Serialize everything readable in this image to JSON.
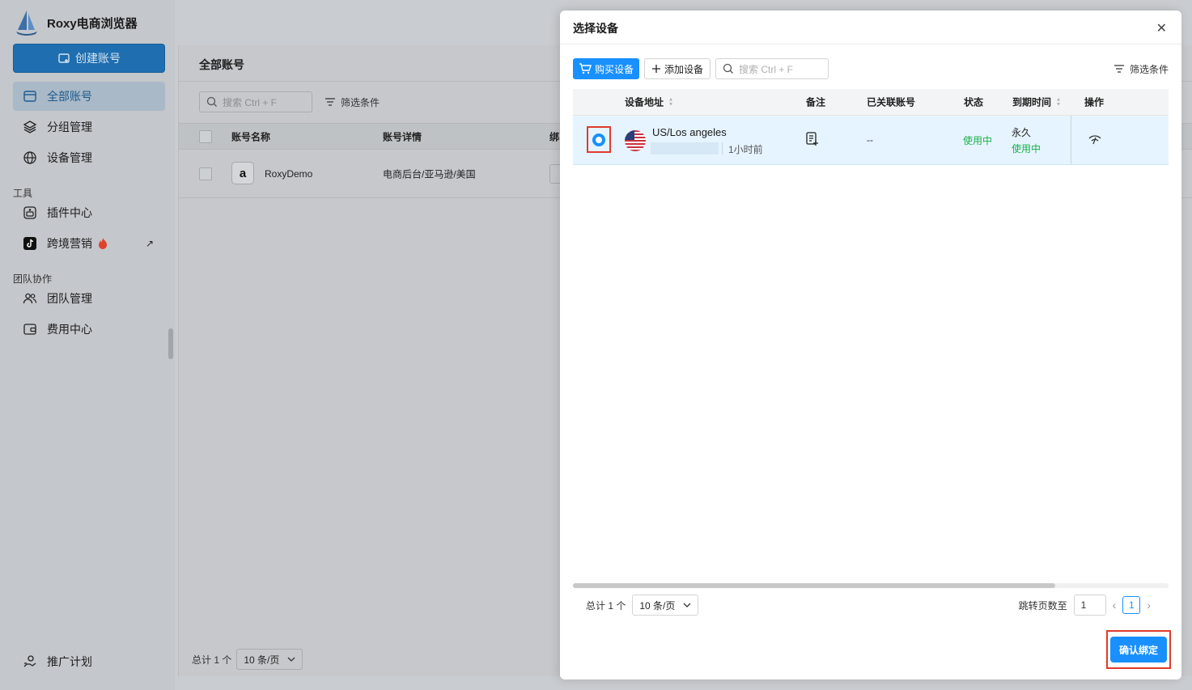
{
  "app": {
    "title": "Roxy电商浏览器"
  },
  "sidebar": {
    "create_label": "创建账号",
    "items": [
      {
        "label": "全部账号",
        "icon": "accounts-icon",
        "active": true
      },
      {
        "label": "分组管理",
        "icon": "layers-icon"
      },
      {
        "label": "设备管理",
        "icon": "globe-icon"
      }
    ],
    "tools_section": "工具",
    "tools": [
      {
        "label": "插件中心",
        "icon": "plugin-icon"
      },
      {
        "label": "跨境营销",
        "icon": "tiktok-icon",
        "badge": "fire-icon",
        "external": "↗"
      }
    ],
    "team_section": "团队协作",
    "team": [
      {
        "label": "团队管理",
        "icon": "team-icon"
      },
      {
        "label": "费用中心",
        "icon": "wallet-icon"
      }
    ],
    "bottom_item": {
      "label": "推广计划",
      "icon": "promo-icon"
    }
  },
  "main": {
    "title": "全部账号",
    "search_placeholder": "搜索 Ctrl + F",
    "filter_label": "筛选条件",
    "columns": [
      "账号名称",
      "账号详情",
      "绑"
    ],
    "rows": [
      {
        "name": "RoxyDemo",
        "detail": "电商后台/亚马逊/美国",
        "logo": "a"
      }
    ],
    "total": "总计 1 个",
    "page_size": "10 条/页"
  },
  "modal": {
    "title": "选择设备",
    "close": "✕",
    "buy_label": "购买设备",
    "add_label": "添加设备",
    "search_placeholder": "搜索 Ctrl + F",
    "filter_label": "筛选条件",
    "columns": {
      "address": "设备地址",
      "note": "备注",
      "linked": "已关联账号",
      "status": "状态",
      "expire": "到期时间",
      "action": "操作"
    },
    "rows": [
      {
        "location": "US/Los angeles",
        "last_used": "1小时前",
        "linked": "--",
        "status": "使用中",
        "expire": "永久",
        "expire_status": "使用中",
        "selected": true
      }
    ],
    "total": "总计 1 个",
    "page_size": "10 条/页",
    "jump_label": "跳转页数至",
    "jump_value": "1",
    "current_page": "1",
    "confirm_label": "确认绑定"
  },
  "colors": {
    "primary": "#1890ff",
    "success": "#18b04a",
    "highlight": "#e03b2c"
  }
}
